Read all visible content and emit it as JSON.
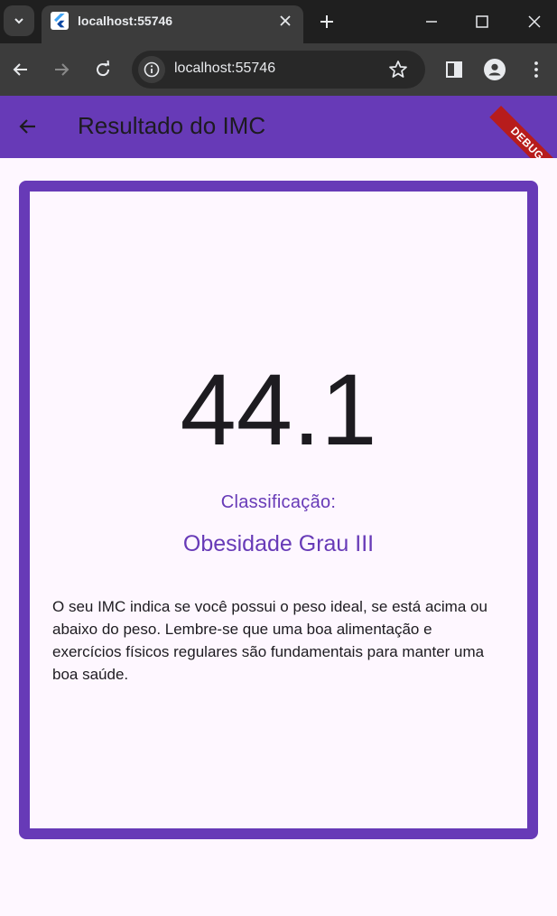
{
  "browser": {
    "tab_title": "localhost:55746",
    "url": "localhost:55746"
  },
  "appbar": {
    "title": "Resultado do IMC",
    "debug_banner": "DEBUG"
  },
  "result": {
    "imc": "44.1",
    "classification_label": "Classificação:",
    "classification": "Obesidade Grau III",
    "description": "O seu IMC indica se você possui o peso ideal, se está acima ou abaixo do peso. Lembre-se que uma boa alimentação e exercícios físicos regulares são fundamentais para manter uma boa saúde."
  },
  "colors": {
    "primary": "#673ab7",
    "background": "#fef7ff",
    "text": "#1d1b20",
    "chrome_dark": "#1f1f1f",
    "chrome_toolbar": "#3c3c3c",
    "debug_banner": "#b71c1c"
  },
  "icons": {
    "tab_search": "chevron-down-icon",
    "favicon": "flutter-logo-icon",
    "tab_close": "close-icon",
    "new_tab": "plus-icon",
    "minimize": "minimize-icon",
    "maximize": "maximize-icon",
    "close_window": "close-window-icon",
    "back": "arrow-left-icon",
    "forward": "arrow-right-icon",
    "reload": "reload-icon",
    "site_info": "info-icon",
    "bookmark": "star-icon",
    "side_panel": "side-panel-icon",
    "profile": "profile-icon",
    "menu": "kebab-menu-icon",
    "app_back": "arrow-back-icon"
  }
}
